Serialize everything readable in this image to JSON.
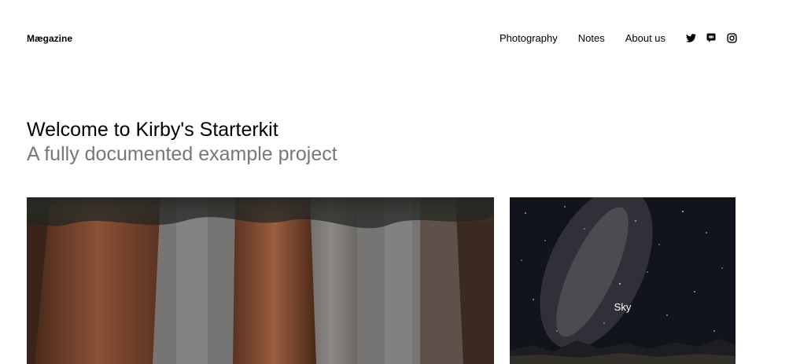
{
  "header": {
    "logo": "Mægazine",
    "nav": [
      {
        "label": "Photography"
      },
      {
        "label": "Notes"
      },
      {
        "label": "About us"
      }
    ],
    "social": [
      {
        "icon": "twitter-icon"
      },
      {
        "icon": "discord-icon"
      },
      {
        "icon": "instagram-icon"
      }
    ]
  },
  "intro": {
    "title": "Welcome to Kirby's Starterkit",
    "subtitle": "A fully documented example project"
  },
  "gallery": {
    "items": [
      {
        "name": "forest",
        "label": ""
      },
      {
        "name": "sky",
        "label": "Sky"
      }
    ]
  },
  "colors": {
    "text": "#000000",
    "subtitle": "#777777",
    "background": "#ffffff"
  }
}
